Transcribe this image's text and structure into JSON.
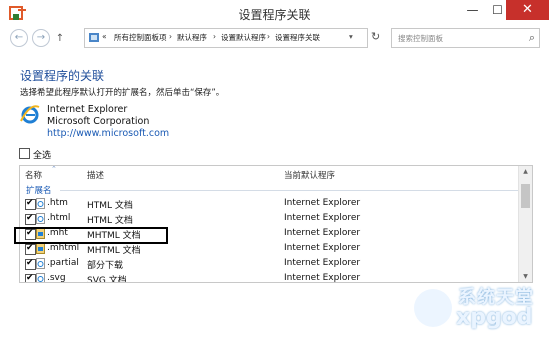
{
  "window": {
    "title": "设置程序关联"
  },
  "titlebar": {
    "minimize": "—",
    "maximize": "☐",
    "close": "✕"
  },
  "nav": {
    "back": "←",
    "forward": "→",
    "up": "↑",
    "breadcrumb": [
      "«",
      "所有控制面板项",
      "›",
      "默认程序",
      "›",
      "设置默认程序",
      "›",
      "设置程序关联"
    ],
    "dropdown": "▾",
    "refresh": "↻",
    "search_placeholder": "搜索控制面板",
    "search_icon": "⌕"
  },
  "main": {
    "title": "设置程序的关联",
    "description": "选择希望此程序默认打开的扩展名，然后单击“保存”。",
    "program": {
      "name": "Internet Explorer",
      "company": "Microsoft Corporation",
      "url": "http://www.microsoft.com"
    },
    "select_all": "全选"
  },
  "table": {
    "columns": [
      "名称",
      "描述",
      "当前默认程序"
    ],
    "group": "扩展名",
    "rows": [
      {
        "ext": ".htm",
        "desc": "HTML 文档",
        "program": "Internet Explorer",
        "checked": true
      },
      {
        "ext": ".html",
        "desc": "HTML 文档",
        "program": "Internet Explorer",
        "checked": true
      },
      {
        "ext": ".mht",
        "desc": "MHTML 文档",
        "program": "Internet Explorer",
        "checked": true
      },
      {
        "ext": ".mhtml",
        "desc": "MHTML 文档",
        "program": "Internet Explorer",
        "checked": true
      },
      {
        "ext": ".partial",
        "desc": "部分下载",
        "program": "Internet Explorer",
        "checked": true
      },
      {
        "ext": ".svg",
        "desc": "SVG 文档",
        "program": "Internet Explorer",
        "checked": true
      }
    ],
    "scroll_up": "▲",
    "scroll_down": "▼"
  },
  "watermark": {
    "line1": "系统天堂",
    "line2": "xpgod"
  },
  "colors": {
    "accent": "#1f4e9b",
    "close": "#c7302b",
    "link": "#1a5ab4"
  }
}
